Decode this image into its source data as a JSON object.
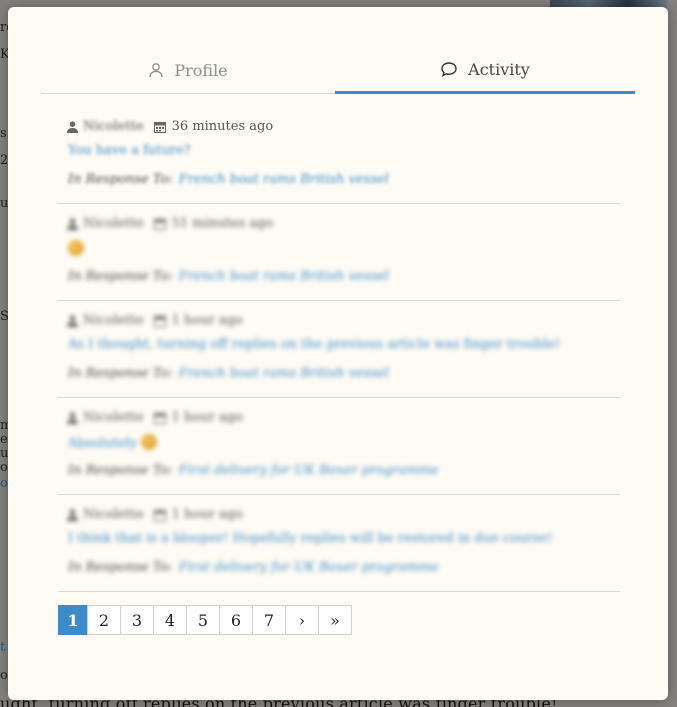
{
  "background": {
    "bottom_text": "ught, turning off replies on the previous article was finger trouble!",
    "left_fragments": [
      "re",
      "K",
      "s",
      "2",
      "u",
      "S",
      "m",
      "e",
      "u",
      "o",
      "o",
      "t",
      "o"
    ]
  },
  "tabs": [
    {
      "label": "Profile",
      "icon": "person-icon",
      "active": false
    },
    {
      "label": "Activity",
      "icon": "speech-bubble-icon",
      "active": true
    }
  ],
  "feed": {
    "entries": [
      {
        "user": "Nicolette",
        "time": "36 minutes ago",
        "message": "You have a future?",
        "response_label": "In Response To:",
        "response_link": "French boat rams British vessel",
        "emoji": false
      },
      {
        "user": "Nicolette",
        "time": "51 minutes ago",
        "message": "",
        "response_label": "In Response To:",
        "response_link": "French boat rams British vessel",
        "emoji": true
      },
      {
        "user": "Nicolette",
        "time": "1 hour ago",
        "message": "As I thought, turning off replies on the previous article was finger trouble!",
        "response_label": "In Response To:",
        "response_link": "French boat rams British vessel",
        "emoji": false
      },
      {
        "user": "Nicolette",
        "time": "1 hour ago",
        "message": "Absolutely",
        "response_label": "In Response To:",
        "response_link": "First delivery for UK Boxer programme",
        "emoji": true
      },
      {
        "user": "Nicolette",
        "time": "1 hour ago",
        "message": "I think that is a blooper! Hopefully replies will be restored in due course!",
        "response_label": "In Response To:",
        "response_link": "First delivery for UK Boxer programme",
        "emoji": false
      }
    ]
  },
  "pagination": {
    "pages": [
      "1",
      "2",
      "3",
      "4",
      "5",
      "6",
      "7"
    ],
    "current": "1",
    "next": "›",
    "last": "»"
  },
  "colors": {
    "accent": "#3d8ac8",
    "modal_bg": "#fdfbf4"
  }
}
